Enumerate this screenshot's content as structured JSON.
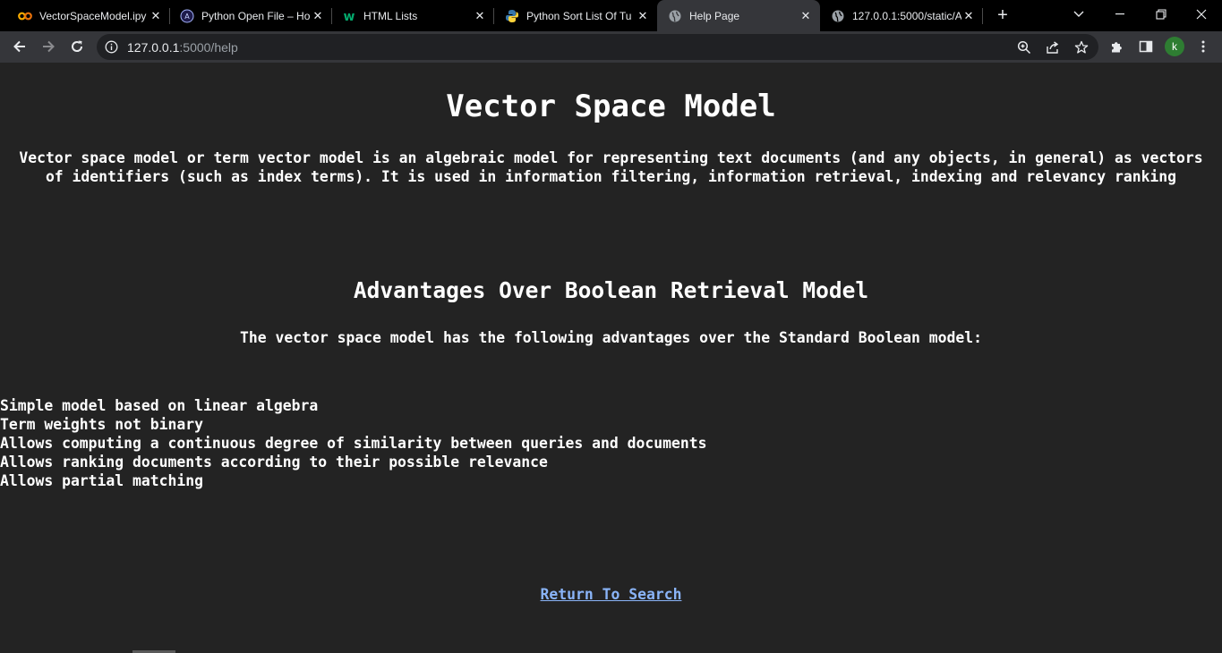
{
  "browser": {
    "tabs": [
      {
        "title": "VectorSpaceModel.ipy",
        "icon": "colab-icon",
        "active": false
      },
      {
        "title": "Python Open File – Ho",
        "icon": "site-icon",
        "active": false
      },
      {
        "title": "HTML Lists",
        "icon": "w3schools-icon",
        "active": false
      },
      {
        "title": "Python Sort List Of Tu",
        "icon": "python-icon",
        "active": false
      },
      {
        "title": "Help Page",
        "icon": "globe-icon",
        "active": true
      },
      {
        "title": "127.0.0.1:5000/static/A",
        "icon": "globe-icon",
        "active": false
      }
    ],
    "url_host": "127.0.0.1",
    "url_rest": ":5000/help",
    "profile_initial": "k"
  },
  "page": {
    "title": "Vector Space Model",
    "intro": "Vector space model or term vector model is an algebraic model for representing text documents (and any objects, in general) as vectors of identifiers (such as index terms). It is used in information filtering, information retrieval, indexing and relevancy ranking",
    "section_title": "Advantages Over Boolean Retrieval Model",
    "section_lead": "The vector space model has the following advantages over the Standard Boolean model:",
    "advantages": [
      "Simple model based on linear algebra",
      "Term weights not binary",
      "Allows computing a continuous degree of similarity between queries and documents",
      "Allows ranking documents according to their possible relevance",
      "Allows partial matching"
    ],
    "return_link": "Return To Search"
  },
  "colors": {
    "background": "#232323",
    "text": "#ffffff",
    "link": "#8ab4f8",
    "chrome_toolbar": "#35363a",
    "chrome_tabstrip": "#000000"
  }
}
